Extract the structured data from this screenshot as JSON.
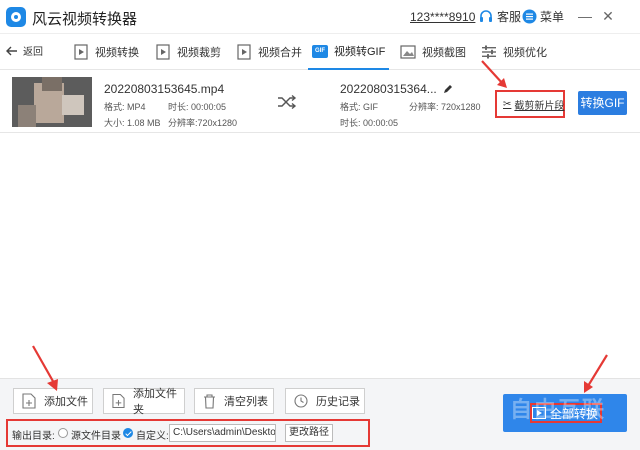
{
  "app": {
    "title": "风云视频转换器",
    "user_id": "123****8910",
    "service_label": "客服",
    "menu_label": "菜单"
  },
  "toolbar": {
    "back_label": "返回",
    "items": [
      {
        "label": "视频转换",
        "icon": "video-convert-icon"
      },
      {
        "label": "视频裁剪",
        "icon": "video-crop-icon"
      },
      {
        "label": "视频合并",
        "icon": "video-merge-icon"
      },
      {
        "label": "视频转GIF",
        "icon": "gif-icon",
        "active": true
      },
      {
        "label": "视频截图",
        "icon": "screenshot-icon"
      },
      {
        "label": "视频优化",
        "icon": "optimize-icon"
      }
    ],
    "gif_badge": "GIF"
  },
  "file": {
    "source_name": "20220803153645.mp4",
    "source_format_label": "格式: MP4",
    "source_duration_label": "时长: 00:00:05",
    "source_size_label": "大小: 1.08 MB",
    "source_resolution_label": "分辨率:720x1280",
    "output_name": "2022080315364...",
    "output_format_label": "格式: GIF",
    "output_resolution_label": "分辨率: 720x1280",
    "output_duration_label": "时长: 00:00:05",
    "trim_label": "截剪新片段",
    "convert_label": "转换GIF"
  },
  "bottom": {
    "add_file": "添加文件",
    "add_folder": "添加文件夹",
    "clear_list": "清空列表",
    "history": "历史记录",
    "output_dir_label": "输出目录:",
    "source_dir_option": "源文件目录",
    "custom_option": "自定义:",
    "path_value": "C:\\Users\\admin\\Desktop",
    "change_path": "更改路径",
    "convert_all": "全部转换"
  },
  "watermark": "自由互联",
  "colors": {
    "accent": "#1e88e5",
    "button_blue": "#2b7de0",
    "highlight_red": "#e53935"
  }
}
